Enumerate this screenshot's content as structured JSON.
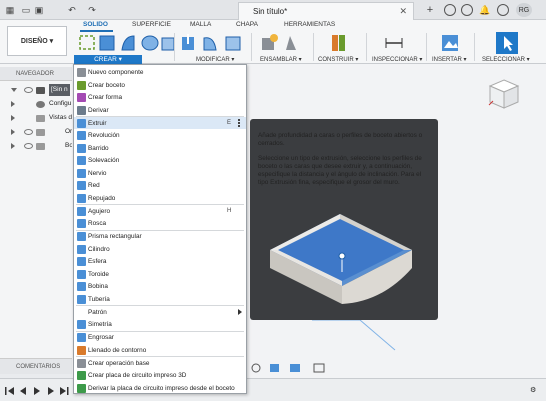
{
  "titlebar": {
    "doc_title": "Sin título*",
    "avatar": "RG"
  },
  "ribbon": {
    "tabs": [
      "SOLIDO",
      "SUPERFICIE",
      "MALLA",
      "CHAPA",
      "HERRAMIENTAS"
    ],
    "active_tab": "SOLIDO",
    "workspace": "DISEÑO ▾",
    "groups": {
      "crear": "CREAR ▾",
      "modificar": "MODIFICAR ▾",
      "ensamblar": "ENSAMBLAR ▾",
      "construir": "CONSTRUIR ▾",
      "inspeccionar": "INSPECCIONAR ▾",
      "insertar": "INSERTAR ▾",
      "seleccionar": "SELECCIONAR ▾"
    }
  },
  "navigator": {
    "header": "NAVEGADOR",
    "rows": [
      "[Sin n",
      "Configu",
      "Vistas d",
      "Ori",
      "Bo"
    ],
    "comments": "COMENTARIOS"
  },
  "menu": {
    "items": [
      {
        "label": "Nuevo componente",
        "shortcut": "",
        "color": "#8a8f96"
      },
      {
        "label": "Crear boceto",
        "shortcut": "",
        "color": "#6a9b2d"
      },
      {
        "label": "Crear forma",
        "shortcut": "",
        "color": "#a44ab3"
      },
      {
        "label": "Derivar",
        "shortcut": "",
        "color": "#6c7c8c"
      },
      {
        "label": "Extruir",
        "shortcut": "E",
        "color": "#4a8fd6"
      },
      {
        "label": "Revolución",
        "shortcut": "",
        "color": "#4a8fd6"
      },
      {
        "label": "Barrido",
        "shortcut": "",
        "color": "#4a8fd6"
      },
      {
        "label": "Solevación",
        "shortcut": "",
        "color": "#4a8fd6"
      },
      {
        "label": "Nervio",
        "shortcut": "",
        "color": "#4a8fd6"
      },
      {
        "label": "Red",
        "shortcut": "",
        "color": "#4a8fd6"
      },
      {
        "label": "Repujado",
        "shortcut": "",
        "color": "#4a8fd6"
      },
      {
        "label": "Agujero",
        "shortcut": "H",
        "color": "#4a8fd6"
      },
      {
        "label": "Rosca",
        "shortcut": "",
        "color": "#4a8fd6"
      },
      {
        "label": "Prisma rectangular",
        "shortcut": "",
        "color": "#4a8fd6"
      },
      {
        "label": "Cilindro",
        "shortcut": "",
        "color": "#4a8fd6"
      },
      {
        "label": "Esfera",
        "shortcut": "",
        "color": "#4a8fd6"
      },
      {
        "label": "Toroide",
        "shortcut": "",
        "color": "#4a8fd6"
      },
      {
        "label": "Bobina",
        "shortcut": "",
        "color": "#4a8fd6"
      },
      {
        "label": "Tubería",
        "shortcut": "",
        "color": "#4a8fd6"
      },
      {
        "label": "Patrón",
        "shortcut": "",
        "color": ""
      },
      {
        "label": "Simetría",
        "shortcut": "",
        "color": "#4a8fd6"
      },
      {
        "label": "Engrosar",
        "shortcut": "",
        "color": "#4a8fd6"
      },
      {
        "label": "Llenado de contorno",
        "shortcut": "",
        "color": "#d97a2b"
      },
      {
        "label": "Crear operación base",
        "shortcut": "",
        "color": "#8a8f96"
      },
      {
        "label": "Crear placa de circuito impreso 3D",
        "shortcut": "",
        "color": "#3d9a4a"
      },
      {
        "label": "Derivar la placa de circuito impreso desde el boceto",
        "shortcut": "",
        "color": "#3d9a4a"
      }
    ],
    "highlighted": "Extruir"
  },
  "tooltip": {
    "para1": "Añade profundidad a caras o perfiles de boceto abiertos o cerrados.",
    "para2": "Seleccione un tipo de extrusión, seleccione los perfiles de boceto o las caras que desee extruir y, a continuación, especifique la distancia y el ángulo de inclinación. Para el tipo Extrusión fina, especifique el grosor del muro."
  },
  "colors": {
    "accent": "#1e78c8",
    "tooltip_bg": "#3b3d40",
    "menu_highlight": "#dbe8f6"
  }
}
